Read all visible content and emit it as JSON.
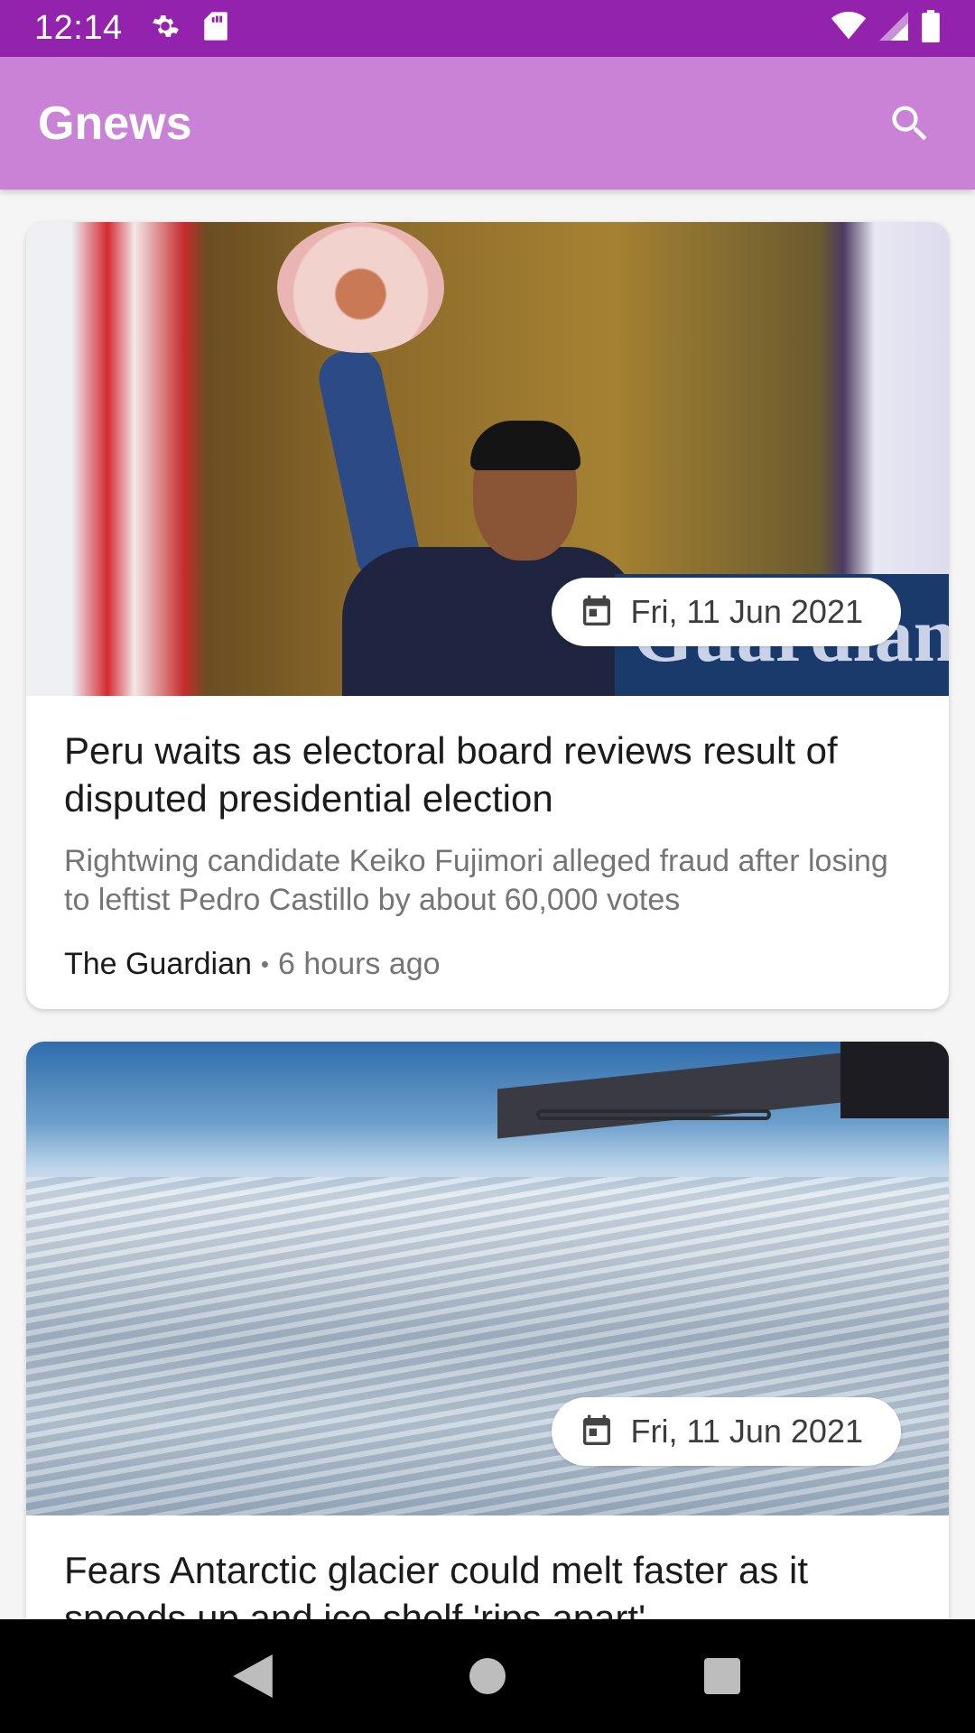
{
  "status_bar": {
    "time": "12:14",
    "icons": [
      "gear-icon",
      "sd-card-icon",
      "wifi-icon",
      "signal-icon",
      "battery-icon"
    ]
  },
  "app_bar": {
    "title": "Gnews",
    "search_icon": "search-icon"
  },
  "articles": [
    {
      "date": "Fri, 11 Jun 2021",
      "title": "Peru waits as electoral board reviews result of disputed presidential election",
      "description": "Rightwing candidate Keiko Fujimori alleged fraud after losing to leftist Pedro Castillo by about 60,000 votes",
      "source": "The Guardian",
      "time_ago": "6 hours ago",
      "image_text": "Guardian"
    },
    {
      "date": "Fri, 11 Jun 2021",
      "title": "Fears Antarctic glacier could melt faster as it speeds up and ice shelf 'rips apart'"
    }
  ],
  "nav_bar": {
    "icons": [
      "back-icon",
      "home-icon",
      "recents-icon"
    ]
  },
  "colors": {
    "status_bar": "#9323ad",
    "app_bar": "#c982d6"
  }
}
